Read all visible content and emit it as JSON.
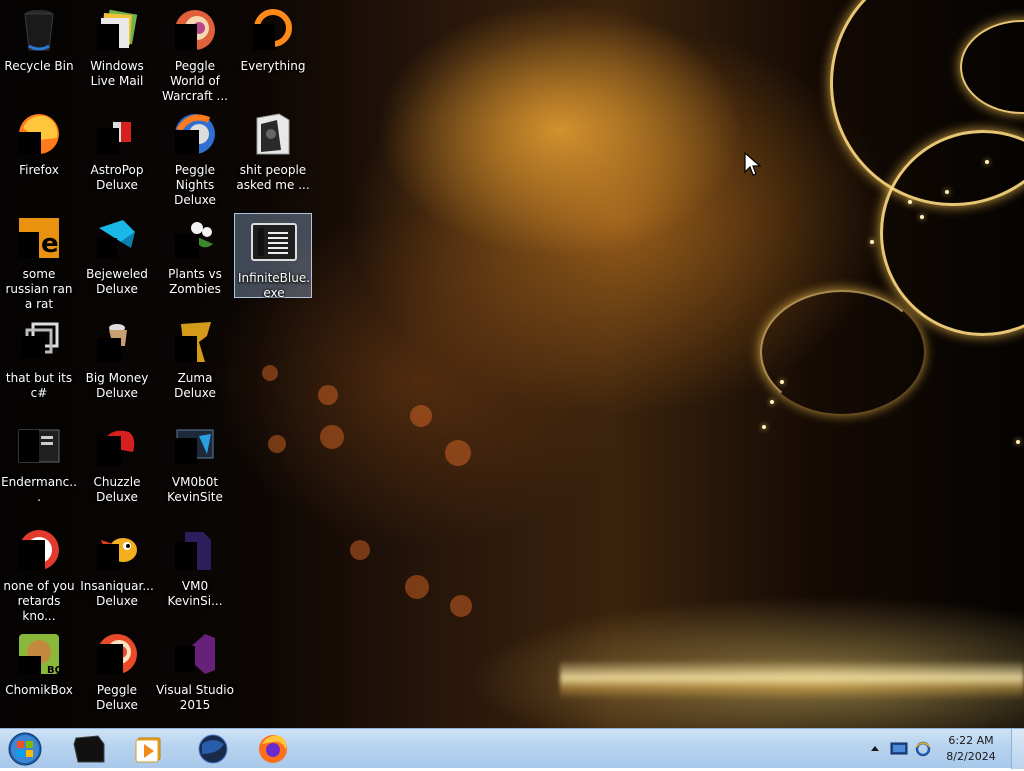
{
  "desktop": {
    "icons": [
      {
        "label": "Recycle Bin",
        "icon": "recycle-bin-icon"
      },
      {
        "label": "Windows Live Mail",
        "icon": "windows-live-mail-icon"
      },
      {
        "label": "Peggle World of Warcraft ...",
        "icon": "peggle-wow-icon"
      },
      {
        "label": "Everything",
        "icon": "everything-icon"
      },
      {
        "label": "Firefox",
        "icon": "firefox-icon"
      },
      {
        "label": "AstroPop Deluxe",
        "icon": "astropop-icon"
      },
      {
        "label": "Peggle Nights Deluxe",
        "icon": "peggle-nights-icon"
      },
      {
        "label": "shit people asked me ...",
        "icon": "folder-icon"
      },
      {
        "label": "some russian ran a rat",
        "icon": "text-file-icon"
      },
      {
        "label": "Bejeweled Deluxe",
        "icon": "bejeweled-icon"
      },
      {
        "label": "Plants vs Zombies",
        "icon": "plants-vs-zombies-icon"
      },
      {
        "label": "InfiniteBlue.exe",
        "icon": "console-app-icon"
      },
      {
        "label": "that but its c#",
        "icon": "shortcut-icon"
      },
      {
        "label": "Big Money Deluxe",
        "icon": "big-money-icon"
      },
      {
        "label": "Zuma Deluxe",
        "icon": "zuma-icon"
      },
      {
        "label": "Endermanc...",
        "icon": "console-app-icon"
      },
      {
        "label": "Chuzzle Deluxe",
        "icon": "chuzzle-icon"
      },
      {
        "label": "VM0b0t KevinSite",
        "icon": "vm-icon"
      },
      {
        "label": "none of you retards kno...",
        "icon": "game-icon"
      },
      {
        "label": "Insaniquar... Deluxe",
        "icon": "insaniquarium-icon"
      },
      {
        "label": "VM0 KevinSi...",
        "icon": "document-icon"
      },
      {
        "label": "ChomikBox",
        "icon": "chomikbox-icon"
      },
      {
        "label": "Peggle Deluxe",
        "icon": "peggle-icon"
      },
      {
        "label": "Visual Studio 2015",
        "icon": "visual-studio-icon"
      }
    ],
    "selected_label": "InfiniteBlue.exe"
  },
  "taskbar": {
    "start_icon": "windows-orb-icon",
    "pinned": [
      {
        "icon": "console-window-icon"
      },
      {
        "icon": "media-player-icon"
      },
      {
        "icon": "internet-browser-icon"
      },
      {
        "icon": "firefox-icon"
      }
    ],
    "tray": {
      "icons": [
        "show-hidden-icons-icon",
        "network-icon",
        "ie-icon"
      ]
    },
    "clock": {
      "time": "6:22 AM",
      "date": "8/2/2024"
    }
  },
  "colors": {
    "taskbar": "#b9d4ef",
    "selection": "#aac8f0",
    "wallpaper_gold": "#e0a030"
  }
}
